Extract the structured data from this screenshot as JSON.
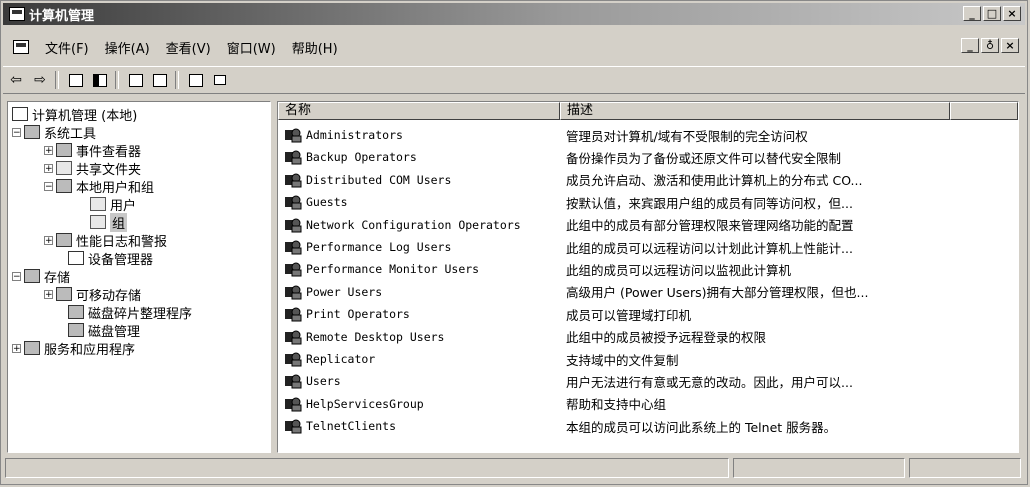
{
  "window": {
    "title": "计算机管理"
  },
  "menu": {
    "items": [
      "文件(F)",
      "操作(A)",
      "查看(V)",
      "窗口(W)",
      "帮助(H)"
    ]
  },
  "caption_buttons": [
    "_",
    "□",
    "×"
  ],
  "mdi_buttons": [
    "_",
    "♁",
    "×"
  ],
  "toolbar": {
    "icons": [
      "back-arrow-icon",
      "forward-arrow-icon",
      "up-folder-icon",
      "show-tree-icon",
      "refresh-icon",
      "export-icon",
      "help-icon",
      "properties-icon"
    ]
  },
  "tree": {
    "items": [
      {
        "label": "计算机管理 (本地)"
      },
      {
        "label": "系统工具"
      },
      {
        "label": "事件查看器"
      },
      {
        "label": "共享文件夹"
      },
      {
        "label": "本地用户和组"
      },
      {
        "label": "用户"
      },
      {
        "label": "组"
      },
      {
        "label": "性能日志和警报"
      },
      {
        "label": "设备管理器"
      },
      {
        "label": "存储"
      },
      {
        "label": "可移动存储"
      },
      {
        "label": "磁盘碎片整理程序"
      },
      {
        "label": "磁盘管理"
      },
      {
        "label": "服务和应用程序"
      }
    ]
  },
  "list": {
    "columns": [
      "名称",
      "描述"
    ],
    "rows": [
      {
        "name": "Administrators",
        "desc": "管理员对计算机/域有不受限制的完全访问权"
      },
      {
        "name": "Backup Operators",
        "desc": "备份操作员为了备份或还原文件可以替代安全限制"
      },
      {
        "name": "Distributed COM Users",
        "desc": "成员允许启动、激活和使用此计算机上的分布式 CO..."
      },
      {
        "name": "Guests",
        "desc": "按默认值，来宾跟用户组的成员有同等访问权，但..."
      },
      {
        "name": "Network Configuration Operators",
        "desc": "此组中的成员有部分管理权限来管理网络功能的配置"
      },
      {
        "name": "Performance Log Users",
        "desc": "此组的成员可以远程访问以计划此计算机上性能计..."
      },
      {
        "name": "Performance Monitor Users",
        "desc": "此组的成员可以远程访问以监视此计算机"
      },
      {
        "name": "Power Users",
        "desc": "高级用户 (Power Users)拥有大部分管理权限，但也..."
      },
      {
        "name": "Print Operators",
        "desc": "成员可以管理域打印机"
      },
      {
        "name": "Remote Desktop Users",
        "desc": "此组中的成员被授予远程登录的权限"
      },
      {
        "name": "Replicator",
        "desc": "支持域中的文件复制"
      },
      {
        "name": "Users",
        "desc": "用户无法进行有意或无意的改动。因此，用户可以..."
      },
      {
        "name": "HelpServicesGroup",
        "desc": "帮助和支持中心组"
      },
      {
        "name": "TelnetClients",
        "desc": "本组的成员可以访问此系统上的 Telnet 服务器。"
      }
    ]
  }
}
